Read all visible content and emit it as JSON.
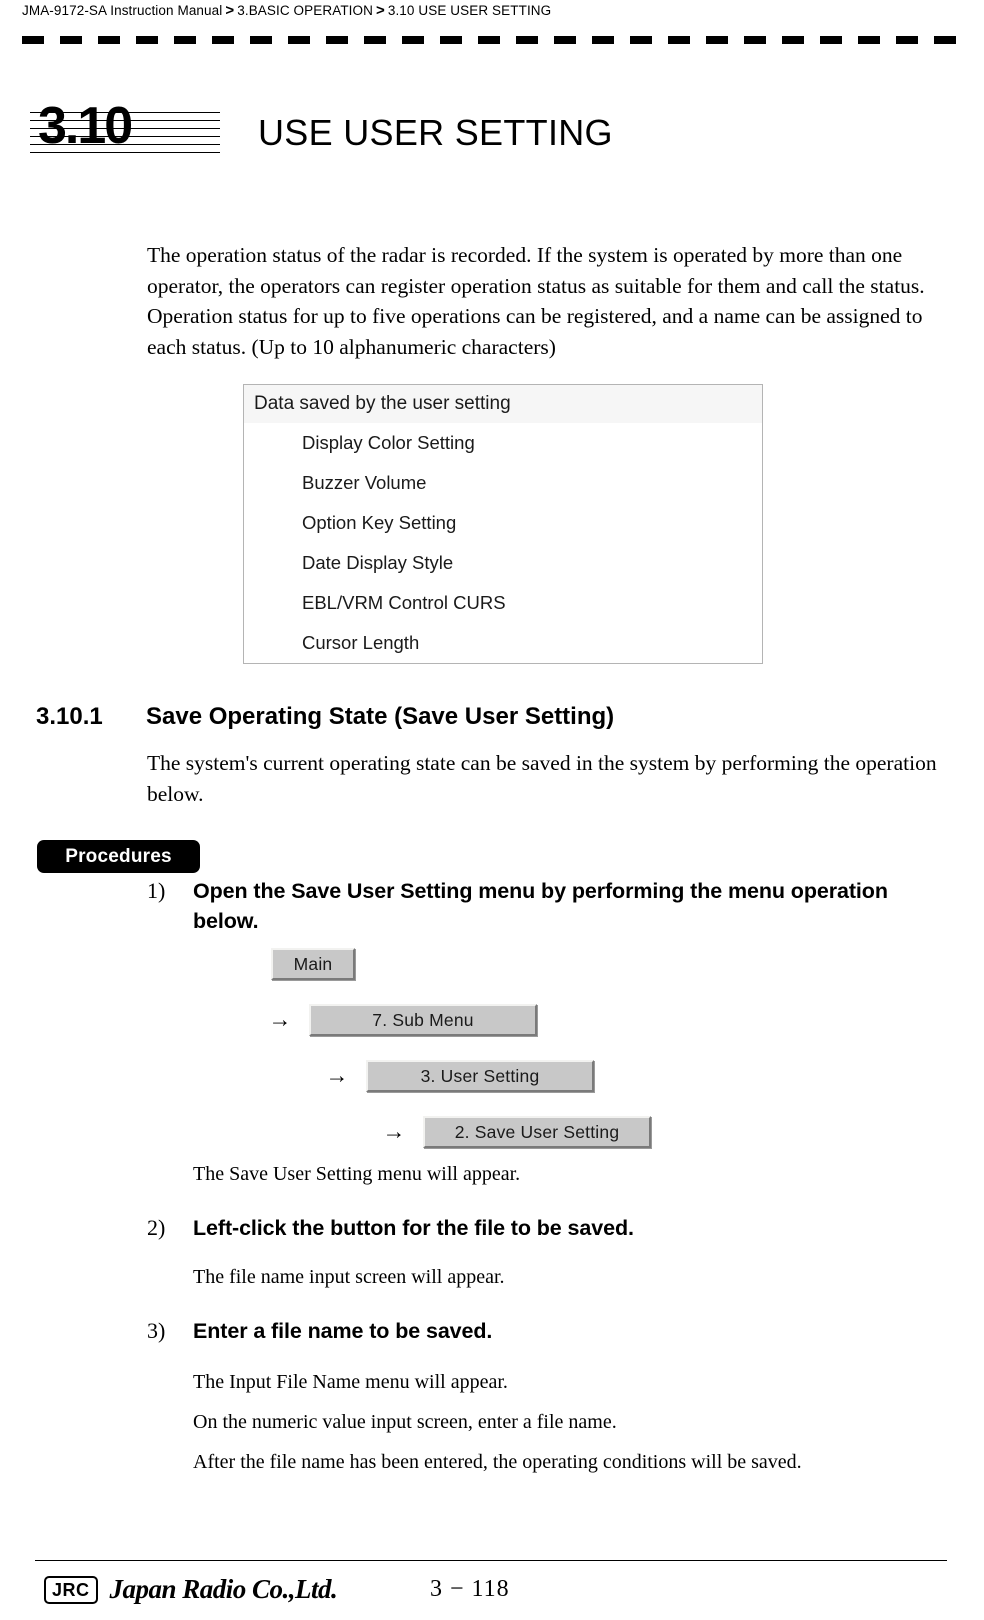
{
  "breadcrumb": {
    "manual": "JMA-9172-SA Instruction Manual",
    "sep": ">",
    "chapter": "3.BASIC OPERATION",
    "section": "3.10  USE USER SETTING"
  },
  "chapter": {
    "number": "3.10",
    "title": "USE USER SETTING"
  },
  "intro": {
    "paragraph": "The operation status of the radar is recorded. If the system is operated by more than one operator, the operators can register operation status as suitable for them and call the status. Operation status for up to five operations can be registered, and a name can be assigned to each status. (Up to 10 alphanumeric characters)"
  },
  "data_table": {
    "header": "Data saved by the user setting",
    "rows": [
      "Display Color Setting",
      "Buzzer Volume",
      "Option Key Setting",
      "Date Display Style",
      "EBL/VRM Control CURS",
      "Cursor Length"
    ]
  },
  "section": {
    "number": "3.10.1",
    "title": "Save Operating State (Save User Setting)",
    "paragraph": "The system's current operating state can be saved in the system by performing the operation below."
  },
  "procedures": {
    "badge": "Procedures",
    "steps": [
      {
        "marker": "1)",
        "text": "Open the Save User Setting menu by performing the menu operation below."
      },
      {
        "marker": "2)",
        "text": "Left-click the button for the file to be saved."
      },
      {
        "marker": "3)",
        "text": "Enter a file name to be saved."
      }
    ],
    "notes": {
      "after_step1": "The Save User Setting menu will appear.",
      "after_step2": "The file name input screen will appear.",
      "after_step3_a": "The Input File Name menu will appear.",
      "after_step3_b": "On the numeric value input screen, enter a file name.",
      "after_step3_c": "After the file name has been entered, the operating conditions will be saved."
    }
  },
  "menu_flow": {
    "arrow": "→",
    "buttons": [
      "Main",
      "7. Sub Menu",
      "3. User Setting",
      "2. Save User Setting"
    ]
  },
  "footer": {
    "logo_mark": "JRC",
    "company": "Japan Radio Co.,Ltd.",
    "page": "3 − 118"
  }
}
